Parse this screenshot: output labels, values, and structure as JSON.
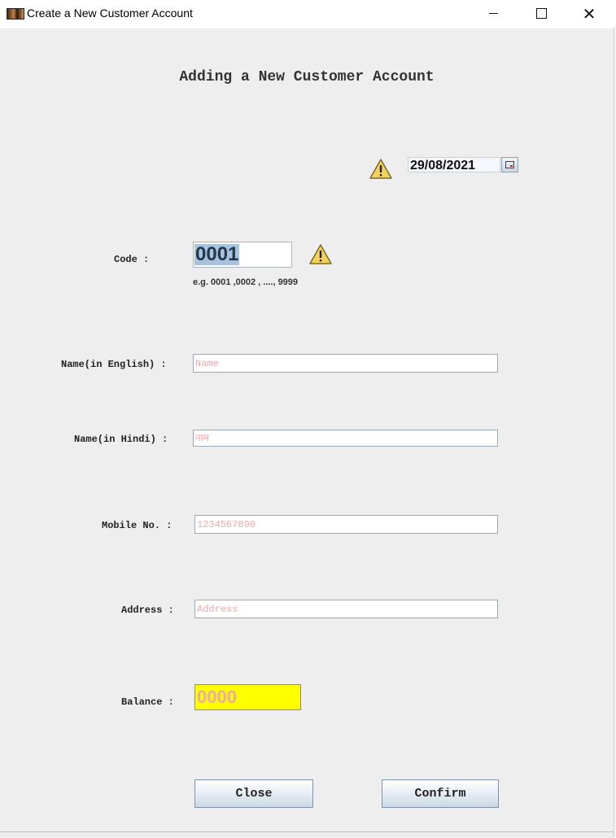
{
  "window": {
    "title": "Create a New Customer Account",
    "controls": {
      "minimize": "minimize",
      "maximize": "maximize",
      "close": "close"
    }
  },
  "form": {
    "heading": "Adding a New Customer Account",
    "date": "29/08/2021",
    "code": {
      "label": "Code :",
      "value": "0001",
      "hint": "e.g. 0001 ,0002 , ...., 9999"
    },
    "name_english": {
      "label": "Name(in English) :",
      "placeholder": "Name"
    },
    "name_hindi": {
      "label": "Name(in Hindi) :",
      "placeholder": "नाम"
    },
    "mobile": {
      "label": "Mobile No. :",
      "placeholder": "1234567890"
    },
    "address": {
      "label": "Address :",
      "placeholder": "Address"
    },
    "balance": {
      "label": "Balance :",
      "placeholder": "0000"
    }
  },
  "buttons": {
    "close": "Close",
    "confirm": "Confirm"
  },
  "icons": {
    "warning": "warning-icon",
    "calendar": "calendar-icon",
    "app": "app-icon"
  },
  "colors": {
    "warning_fill": "#f2d25a",
    "placeholder": "#f2a8a8",
    "balance_bg": "#ffff00",
    "selection": "#a8c3df",
    "panel_bg": "#eeeeee"
  }
}
